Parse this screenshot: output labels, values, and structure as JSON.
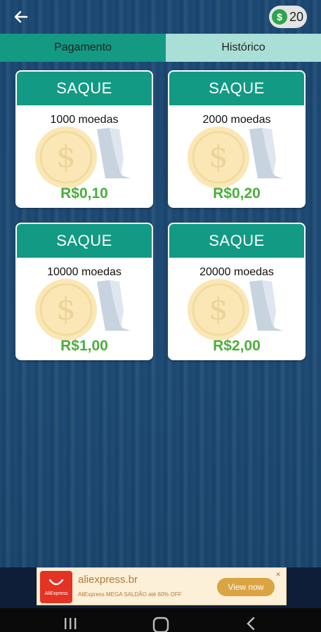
{
  "header": {
    "back_icon": "arrow-left-icon",
    "coin_icon": "dollar-coin-icon",
    "coin_symbol": "$",
    "coin_count": "20"
  },
  "tabs": [
    {
      "label": "Pagamento",
      "active": true
    },
    {
      "label": "Histórico",
      "active": false
    }
  ],
  "cards": [
    {
      "title": "SAQUE",
      "coins": "1000 moedas",
      "price": "R$0,10"
    },
    {
      "title": "SAQUE",
      "coins": "2000 moedas",
      "price": "R$0,20"
    },
    {
      "title": "SAQUE",
      "coins": "10000 moedas",
      "price": "R$1,00"
    },
    {
      "title": "SAQUE",
      "coins": "20000 moedas",
      "price": "R$2,00"
    }
  ],
  "ad": {
    "logo_text": "AliExpress",
    "title": "aliexpress.br",
    "description": "AliExpress MEGA SALDÃO até 60% OFF",
    "cta": "View now"
  },
  "colors": {
    "accent": "#129a84",
    "tab_inactive": "#a9dfd6",
    "price": "#4cae3c",
    "background": "#1d4b77"
  },
  "navbar": {
    "icons": [
      "recent-apps-icon",
      "home-icon",
      "back-nav-icon"
    ]
  }
}
